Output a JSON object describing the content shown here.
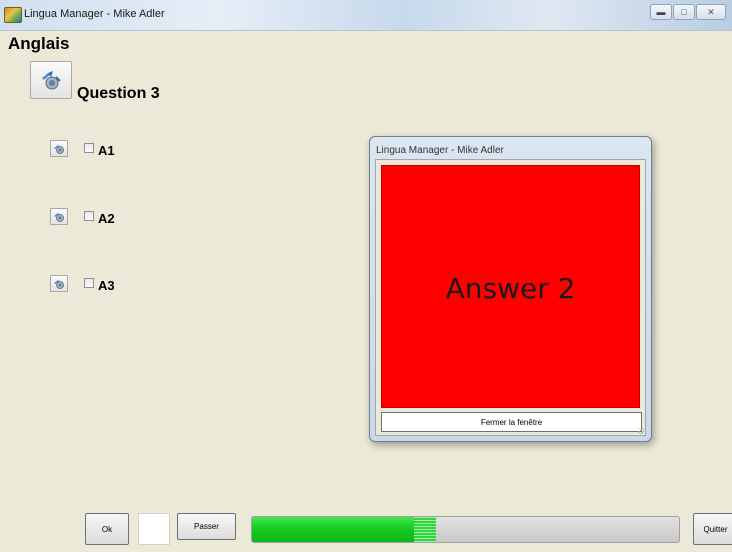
{
  "window": {
    "title": "Lingua Manager - Mike Adler",
    "controls": [
      "minimize",
      "maximize",
      "close"
    ]
  },
  "header": {
    "language": "Anglais",
    "question": "Question 3"
  },
  "answers": [
    {
      "label": "A1",
      "checked": false
    },
    {
      "label": "A2",
      "checked": false
    },
    {
      "label": "A3",
      "checked": false
    }
  ],
  "popup": {
    "title": "Lingua Manager - Mike Adler",
    "answer_text": "Answer 2",
    "answer_bg": "#ff0000",
    "close_button": "Fermer la fenêtre"
  },
  "footer": {
    "ok_label": "Ok",
    "skip_label": "Passer",
    "quit_label": "Quitter",
    "progress": 0.43
  },
  "icons": {
    "app": "app-icon",
    "speaker": "speaker-icon"
  }
}
